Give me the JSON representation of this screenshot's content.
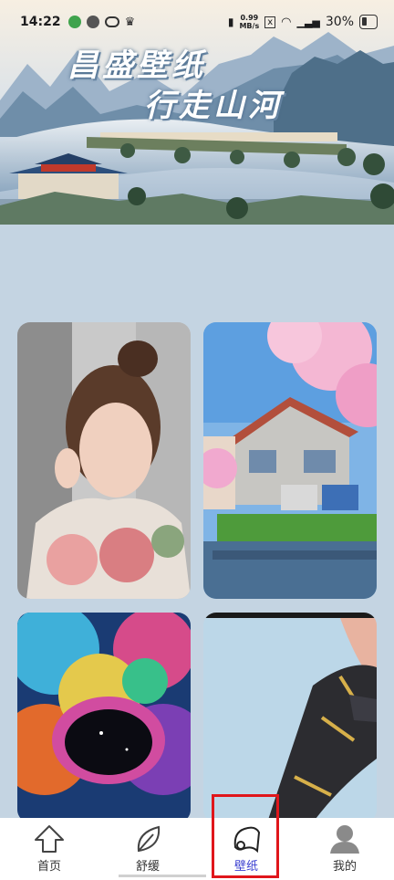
{
  "status_bar": {
    "time": "14:22",
    "net_speed_value": "0.99",
    "net_speed_unit": "MB/s",
    "battery": "30%"
  },
  "banner": {
    "title_line1": "昌盛壁纸",
    "title_line2": "行走山河"
  },
  "wallpapers": [
    {
      "subject": "portrait of woman in floral dress"
    },
    {
      "subject": "anime street with cherry blossoms"
    },
    {
      "subject": "colorful cosmic nebula"
    },
    {
      "subject": "character boots on light blue"
    }
  ],
  "bottom_nav": {
    "items": [
      {
        "label": "首页",
        "icon": "home-icon"
      },
      {
        "label": "舒缓",
        "icon": "leaf-icon"
      },
      {
        "label": "壁纸",
        "icon": "scroll-icon",
        "active": true
      },
      {
        "label": "我的",
        "icon": "user-icon"
      }
    ]
  },
  "colors": {
    "background": "#c4d4e2",
    "active_nav": "#3a3fd0",
    "highlight_box": "#e0161b"
  }
}
